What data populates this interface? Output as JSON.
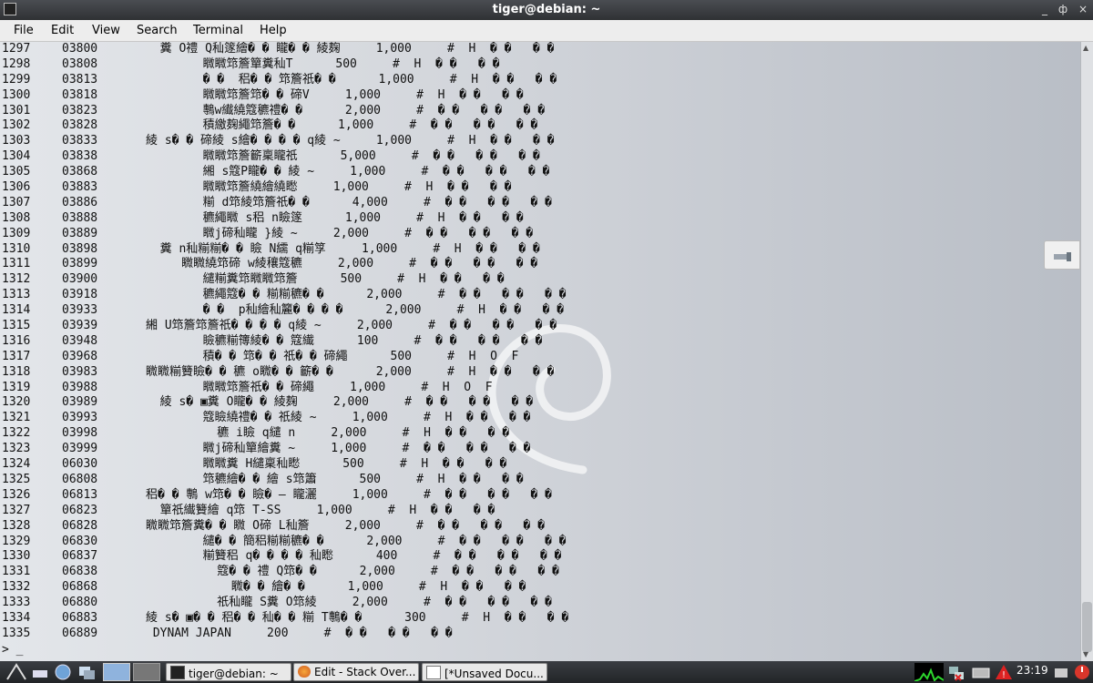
{
  "window": {
    "title": "tiger@debian: ~",
    "controls": {
      "minimize": "_",
      "maximize": "ф",
      "close": "×"
    }
  },
  "menu": [
    "File",
    "Edit",
    "View",
    "Search",
    "Terminal",
    "Help"
  ],
  "terminal": {
    "lines": [
      {
        "ln": "1297",
        "code": "03800",
        "txt": "  糞 O禮 Q秈篴繪� � 矓� � 綾麹     1,000     #  H  � �   � �"
      },
      {
        "ln": "1298",
        "code": "03808",
        "txt": "        矀矀筇簷簞糞秈T      500     #  H  � �   � �"
      },
      {
        "ln": "1299",
        "code": "03813",
        "txt": "        � �  稆� � 筇簷祇� �      1,000     #  H  � �   � �"
      },
      {
        "ln": "1300",
        "code": "03818",
        "txt": "        矀矀筇簷筇� � 碲V     1,000     #  H  � �   � �"
      },
      {
        "ln": "1301",
        "code": "03823",
        "txt": "        鷒w纎繞簆穮禮� �      2,000     #  � �   � �   � �"
      },
      {
        "ln": "1302",
        "code": "03828",
        "txt": "        積繳麹繩筇簷� �      1,000     #  � �   � �   � �"
      },
      {
        "ln": "1303",
        "code": "03833",
        "txt": "綾 s� � 碲綾 s繪� � � � q綾 ~     1,000     #  H  � �   � �"
      },
      {
        "ln": "1304",
        "code": "03838",
        "txt": "        矀矀筇簷籪稟矓祇      5,000     #  � �   � �   � �"
      },
      {
        "ln": "1305",
        "code": "03868",
        "txt": "        緗 s簆P矓� � 綾 ~     1,000     #  � �   � �   � �"
      },
      {
        "ln": "1306",
        "code": "03883",
        "txt": "        矀矀筇簷繞繪繞矁     1,000     #  H  � �   � �"
      },
      {
        "ln": "1307",
        "code": "03886",
        "txt": "        糋 d筇綾筇簷祇� �      4,000     #  � �   � �   � �"
      },
      {
        "ln": "1308",
        "code": "03888",
        "txt": "        穮繩矀 s稆 n瞼篴      1,000     #  H  � �   � �"
      },
      {
        "ln": "1309",
        "code": "03889",
        "txt": "        矀j碲秈矓 }綾 ~     2,000     #  � �   � �   � �"
      },
      {
        "ln": "1310",
        "code": "03898",
        "txt": "  糞 n秈糋糋� � 瞼 N繻 q糋筟     1,000     #  H  � �   � �"
      },
      {
        "ln": "1311",
        "code": "03899",
        "txt": "     矀矀繞筇碲 w綾穰簆穮     2,000     #  � �   � �   � �"
      },
      {
        "ln": "1312",
        "code": "03900",
        "txt": "        繾糋糞筇矀矀筇簷      500     #  H  � �   � �"
      },
      {
        "ln": "1313",
        "code": "03918",
        "txt": "        穮繩簆� � 糋糋穮� �      2,000     #  � �   � �   � �"
      },
      {
        "ln": "1314",
        "code": "03933",
        "txt": "        � �  p秈繪秈籭� � � �      2,000     #  H  � �   � �"
      },
      {
        "ln": "1315",
        "code": "03939",
        "txt": "緗 U筇簷筇簷祇� � � � q綾 ~     2,000     #  � �   � �   � �"
      },
      {
        "ln": "1316",
        "code": "03948",
        "txt": "        瞼穮糋簙綾� � 簆纎      100     #  � �   � �   � �"
      },
      {
        "ln": "1317",
        "code": "03968",
        "txt": "        積� � 筇� � 祇� � 碲繩      500     #  H  O  F"
      },
      {
        "ln": "1318",
        "code": "03983",
        "txt": "矀矀糋籫瞼� � 穮 o矀� � 籪� �      2,000     #  H  � �   � �"
      },
      {
        "ln": "1319",
        "code": "03988",
        "txt": "        矀矀筇簷祇� � 碲繩     1,000     #  H  O  F"
      },
      {
        "ln": "1320",
        "code": "03989",
        "txt": "  綾 s� ▣糞 O矓� � 綾麹     2,000     #  � �   � �   � �"
      },
      {
        "ln": "1321",
        "code": "03993",
        "txt": "        簆瞼繞禮� � 祇綾 ~     1,000     #  H  � �   � �"
      },
      {
        "ln": "1322",
        "code": "03998",
        "txt": "          穮 i瞼 q繾 n     2,000     #  H  � �   � �"
      },
      {
        "ln": "1323",
        "code": "03999",
        "txt": "        矀j碲秈簞繪糞 ~     1,000     #  � �   � �   � �"
      },
      {
        "ln": "1324",
        "code": "06030",
        "txt": "        矀矀糞 H繾稟秈矁      500     #  H  � �   � �"
      },
      {
        "ln": "1325",
        "code": "06808",
        "txt": "        筇穮繪� � 繪 s筇簫      500     #  H  � �   � �"
      },
      {
        "ln": "1326",
        "code": "06813",
        "txt": "稆� � 鷒 w筇� � 瞼� — 矓灑     1,000     #  � �   � �   � �"
      },
      {
        "ln": "1327",
        "code": "06823",
        "txt": "  簞祇纎籫繪 q筇 T-SS     1,000     #  H  � �   � �"
      },
      {
        "ln": "1328",
        "code": "06828",
        "txt": "矀矀筇簷糞� � 矀 O碲 L秈簷     2,000     #  � �   � �   � �"
      },
      {
        "ln": "1329",
        "code": "06830",
        "txt": "        繾� � 簡稆糋糋穮� �      2,000     #  � �   � �   � �"
      },
      {
        "ln": "1330",
        "code": "06837",
        "txt": "        糋籫稆 q� � � � 秈矁      400     #  � �   � �   � �"
      },
      {
        "ln": "1331",
        "code": "06838",
        "txt": "          簆� � 禮 Q筇� �      2,000     #  � �   � �   � �"
      },
      {
        "ln": "1332",
        "code": "06868",
        "txt": "            矀� � 繪� �      1,000     #  H  � �   � �"
      },
      {
        "ln": "1333",
        "code": "06880",
        "txt": "          祇秈矓 S糞 O筇綾     2,000     #  � �   � �   � �"
      },
      {
        "ln": "1334",
        "code": "06883",
        "txt": "綾 s� ▣� � 稆� � 秈� � 糋 T鷒� �      300     #  H  � �   � �"
      },
      {
        "ln": "1335",
        "code": "06889",
        "txt": " DYNAM JAPAN     200     #  � �   � �   � �"
      }
    ],
    "prompt": "> _"
  },
  "taskbar": {
    "tasks": [
      "tiger@debian: ~",
      "Edit - Stack Over...",
      "[*Unsaved Docu..."
    ],
    "clock": "23:19"
  },
  "colors": {
    "titlebar": "#3a3d42",
    "menubar": "#ededed",
    "terminal_bg": "#cfd2d7",
    "taskbar": "#2b2d31"
  },
  "icons": [
    "terminal-icon",
    "minimize-icon",
    "maximize-icon",
    "close-icon",
    "menu-icon",
    "show-desktop-icon",
    "browser-icon",
    "window-switch-icon",
    "workspace-1",
    "workspace-2",
    "firefox-icon",
    "document-icon",
    "cpu-graph",
    "network-icon",
    "battery-icon",
    "warning-icon",
    "audio-icon",
    "power-icon"
  ]
}
